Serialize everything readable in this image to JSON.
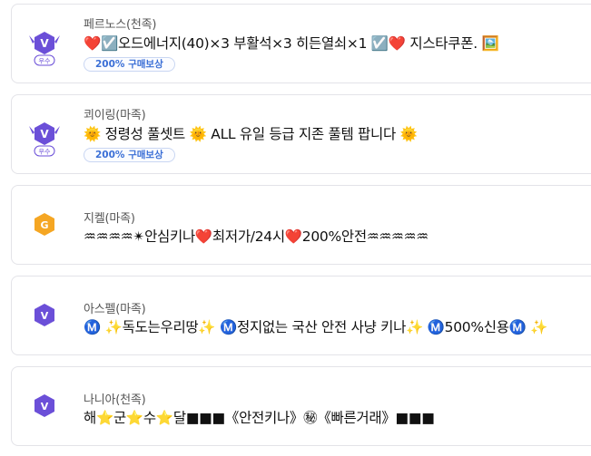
{
  "listings": [
    {
      "server": "페르노스(천족)",
      "title": "❤️☑️오드에너지(40)×3 부활석×3 히든열쇠×1 ☑️❤️ 지스타쿠폰. 🖼️",
      "tag": "200% 구매보상",
      "seller_badge": "winged-v-badge",
      "seller_grade": "우수",
      "badge_color": "#6b4fd8"
    },
    {
      "server": "쾨이링(마족)",
      "title": "🌞 정령성 풀셋트 🌞 ALL 유일 등급 지존 풀템 팝니다 🌞",
      "tag": "200% 구매보상",
      "seller_badge": "winged-v-badge",
      "seller_grade": "우수",
      "badge_color": "#6b4fd8"
    },
    {
      "server": "지켈(마족)",
      "title": "♒♒♒♒✴안심키나❤️최저가/24시❤️200%안전♒♒♒♒♒",
      "tag": "",
      "seller_badge": "gold-g-badge",
      "seller_grade": "",
      "badge_color": "#f5a623"
    },
    {
      "server": "아스펠(마족)",
      "title": "Ⓜ️ ✨독도는우리땅✨ Ⓜ️정지없는 국산 안전 사냥 키나✨ Ⓜ️500%신용Ⓜ️ ✨",
      "tag": "",
      "seller_badge": "v-badge",
      "seller_grade": "",
      "badge_color": "#6b4fd8"
    },
    {
      "server": "나니아(천족)",
      "title": "해⭐군⭐수⭐달■■■《안전키나》㊙《빠른거래》■■■",
      "tag": "",
      "seller_badge": "v-badge",
      "seller_grade": "",
      "badge_color": "#6b4fd8"
    }
  ]
}
